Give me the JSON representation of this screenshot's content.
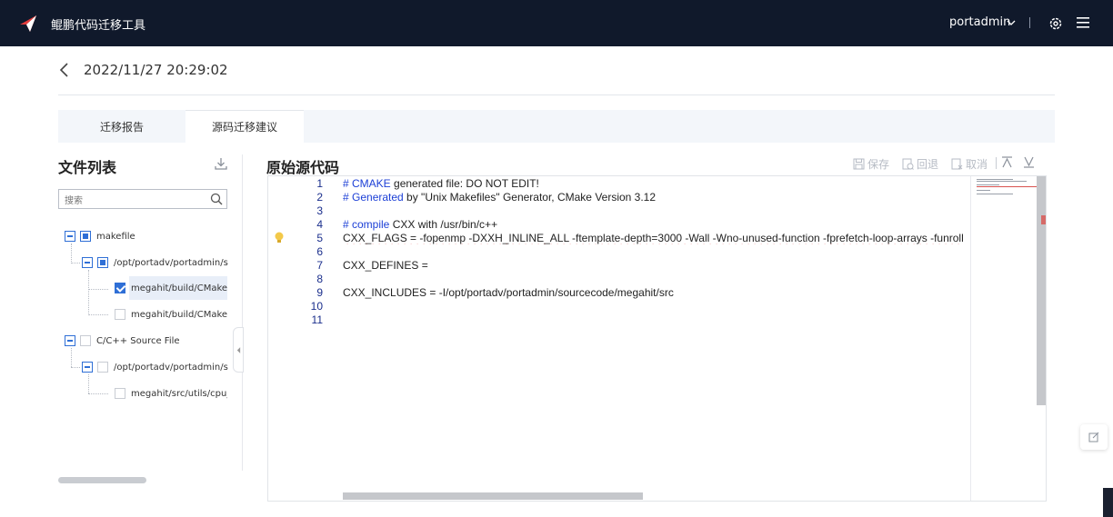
{
  "header": {
    "app_title": "鲲鹏代码迁移工具",
    "user": "portadmin",
    "icons": [
      "logo-icon",
      "chevron-down-icon",
      "gear-icon",
      "menu-icon"
    ]
  },
  "page": {
    "datetime": "2022/11/27 20:29:02",
    "tabs": [
      {
        "label": "迁移报告",
        "active": false
      },
      {
        "label": "源码迁移建议",
        "active": true
      }
    ]
  },
  "file_list": {
    "title": "文件列表",
    "search_placeholder": "搜索",
    "tree": [
      {
        "label": "makefile",
        "state": "partial"
      },
      {
        "label": "/opt/portadv/portadmin/sourcecode/megahit",
        "state": "partial"
      },
      {
        "label": "megahit/build/CMakeFiles/megahit_core_no_hw_accel.dir/flags.make",
        "state": "checked"
      },
      {
        "label": "megahit/build/CMakeFiles/megahit_core.dir/flags.make",
        "state": "unchecked"
      },
      {
        "label": "C/C++ Source File",
        "state": "unchecked"
      },
      {
        "label": "/opt/portadv/portadmin/sourcecode/megahit",
        "state": "unchecked"
      },
      {
        "label": "megahit/src/utils/cpu_dispatch.h",
        "state": "unchecked"
      }
    ]
  },
  "source": {
    "title": "原始源代码",
    "toolbar": {
      "save": "保存",
      "rollback": "回退",
      "cancel": "取消"
    },
    "line_numbers": [
      "1",
      "2",
      "3",
      "4",
      "5",
      "6",
      "7",
      "8",
      "9",
      "10",
      "11"
    ],
    "lines": [
      {
        "kw": "# CMAKE",
        "rest": " generated file: DO NOT EDIT!"
      },
      {
        "kw": "# Generated",
        "rest": " by \"Unix Makefiles\" Generator, CMake Version 3.12"
      },
      {
        "kw": "",
        "rest": ""
      },
      {
        "kw": "# compile",
        "rest": " CXX with /usr/bin/c++"
      },
      {
        "kw": "",
        "rest": "CXX_FLAGS =  -fopenmp -DXXH_INLINE_ALL -ftemplate-depth=3000 -Wall -Wno-unused-function -fprefetch-loop-arrays -funroll"
      },
      {
        "kw": "",
        "rest": ""
      },
      {
        "kw": "",
        "rest": "CXX_DEFINES ="
      },
      {
        "kw": "",
        "rest": ""
      },
      {
        "kw": "",
        "rest": "CXX_INCLUDES = -I/opt/portadv/portadmin/sourcecode/megahit/src"
      },
      {
        "kw": "",
        "rest": ""
      },
      {
        "kw": "",
        "rest": ""
      }
    ]
  }
}
